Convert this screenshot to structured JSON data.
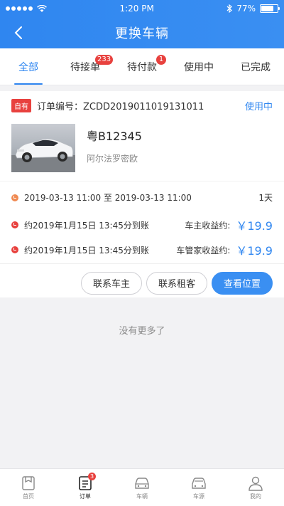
{
  "status_bar": {
    "time": "1:20 PM",
    "battery_text": "77%",
    "battery_level": 0.77
  },
  "nav": {
    "title": "更换车辆"
  },
  "tabs": [
    {
      "label": "全部",
      "badge": "",
      "active": true
    },
    {
      "label": "待接单",
      "badge": "233"
    },
    {
      "label": "待付款",
      "badge": "1"
    },
    {
      "label": "使用中",
      "badge": ""
    },
    {
      "label": "已完成",
      "badge": ""
    }
  ],
  "order": {
    "tag": "自有",
    "number": "订单编号：ZCDD2019011019131011",
    "status": "使用中",
    "plate": "粤B12345",
    "model": "阿尔法罗密欧",
    "period": "2019-03-13 11:00 至 2019-03-13 11:00",
    "days": "1天",
    "owner_settle": "约2019年1月15日 13:45分到账",
    "owner_income_label": "车主收益约:",
    "owner_income": "￥19.9",
    "manager_settle": "约2019年1月15日 13:45分到账",
    "manager_income_label": "车管家收益约:",
    "manager_income": "￥19.9"
  },
  "actions": {
    "contact_owner": "联系车主",
    "contact_renter": "联系租客",
    "view_location": "查看位置"
  },
  "list_end": "没有更多了",
  "tabbar": [
    {
      "label": "首页",
      "icon": "home-icon"
    },
    {
      "label": "订单",
      "icon": "order-icon",
      "badge": "3",
      "active": true
    },
    {
      "label": "车辆",
      "icon": "car-icon"
    },
    {
      "label": "车源",
      "icon": "car-source-icon"
    },
    {
      "label": "我的",
      "icon": "profile-icon"
    }
  ],
  "colors": {
    "primary": "#2f86f0",
    "badge": "#e8413e",
    "orange": "#f08a52"
  }
}
